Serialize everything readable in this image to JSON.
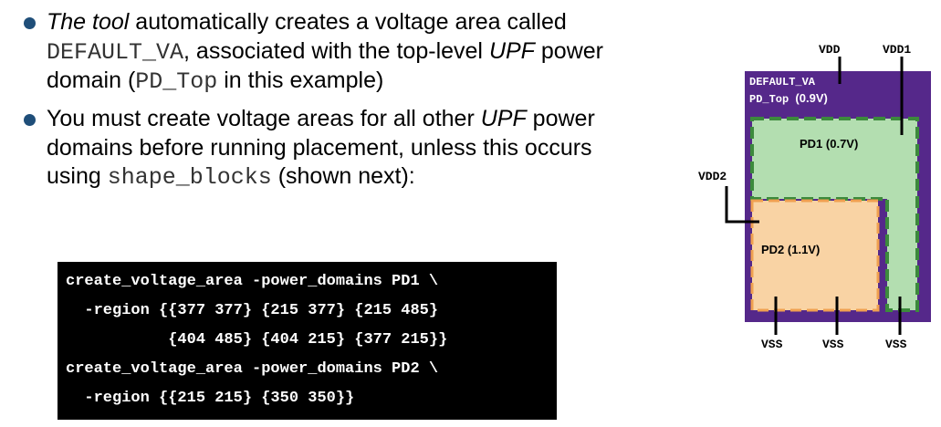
{
  "bullets": [
    {
      "parts": [
        {
          "t": "The tool",
          "style": "it"
        },
        {
          "t": " automatically creates a voltage area called ",
          "style": ""
        },
        {
          "t": "DEFAULT_VA",
          "style": "mono"
        },
        {
          "t": ", associated with the top-level ",
          "style": ""
        },
        {
          "t": "UPF",
          "style": "it"
        },
        {
          "t": " power domain (",
          "style": ""
        },
        {
          "t": "PD_Top",
          "style": "mono"
        },
        {
          "t": " in this example)",
          "style": ""
        }
      ]
    },
    {
      "parts": [
        {
          "t": "You must create voltage areas for all other ",
          "style": ""
        },
        {
          "t": "UPF",
          "style": "it"
        },
        {
          "t": " power domains before running placement, unless this occurs using ",
          "style": ""
        },
        {
          "t": "shape_blocks",
          "style": "mono"
        },
        {
          "t": " (shown next):",
          "style": ""
        }
      ]
    }
  ],
  "code": {
    "lines": [
      "create_voltage_area -power_domains PD1 \\",
      "  -region {{377 377} {215 377} {215 485}",
      "           {404 485} {404 215} {377 215}}",
      "create_voltage_area -power_domains PD2 \\",
      "  -region {{215 215} {350 350}}"
    ]
  },
  "diagram": {
    "vdd": "VDD",
    "vdd1": "VDD1",
    "vdd2": "VDD2",
    "default_va": "DEFAULT_VA",
    "pd_top": "PD_Top",
    "pd_top_voltage": "(0.9V)",
    "pd1": "PD1 (0.7V)",
    "pd2": "PD2 (1.1V)",
    "vss": [
      "VSS",
      "VSS",
      "VSS"
    ],
    "colors": {
      "default_va": "#55288a",
      "pd1_fill": "#b3deb0",
      "pd1_border": "#3c8a3c",
      "pd2_fill": "#f9d3a4",
      "pd2_border": "#f0a050",
      "bullet": "#1f4e79"
    }
  }
}
